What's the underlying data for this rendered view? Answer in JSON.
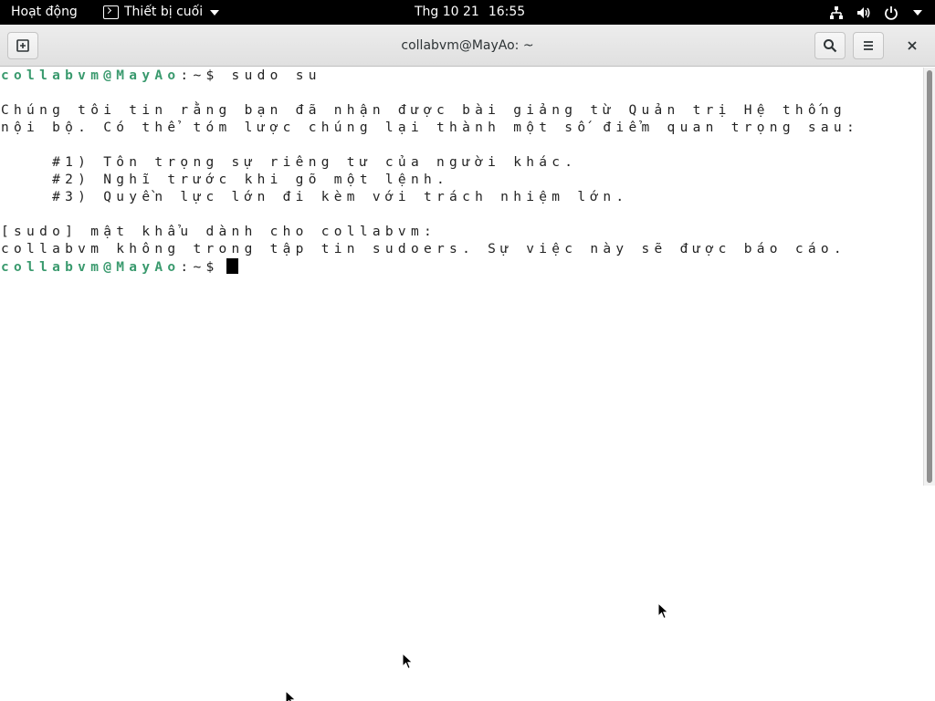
{
  "topbar": {
    "activities_label": "Hoạt động",
    "app_menu_label": "Thiết bị cuối",
    "clock_date": "Thg 10 21",
    "clock_time": "16:55",
    "status_icons": [
      "network-wired-icon",
      "volume-icon",
      "power-icon",
      "dropdown-arrow-icon"
    ]
  },
  "window": {
    "title": "collabvm@MayAo: ~",
    "buttons": [
      "new-tab",
      "search",
      "menu",
      "close"
    ]
  },
  "terminal": {
    "colors": {
      "prompt_user": "#3a9a6e",
      "text": "#222222",
      "background": "#ffffff"
    },
    "prompt_user": "collabvm@MayAo",
    "prompt_rest": ":~$",
    "lines": {
      "cmd": " sudo su",
      "l1": "Chúng tôi tin rằng bạn đã nhận được bài giảng từ Quản trị Hệ thống",
      "l2": "nội bộ. Có thể tóm lược chúng lại thành một số điểm quan trọng sau:",
      "l3": "    #1) Tôn trọng sự riêng tư của người khác.",
      "l4": "    #2) Nghĩ trước khi gõ một lệnh.",
      "l5": "    #3) Quyền lực lớn đi kèm với trách nhiệm lớn.",
      "l6": "[sudo] mật khẩu dành cho collabvm:",
      "l7": "collabvm không trong tập tin sudoers. Sự việc này sẽ được báo cáo."
    }
  },
  "desktop": {
    "pointer_icons": [
      "mouse-pointer-icon",
      "mouse-pointer-icon",
      "mouse-pointer-icon"
    ]
  }
}
